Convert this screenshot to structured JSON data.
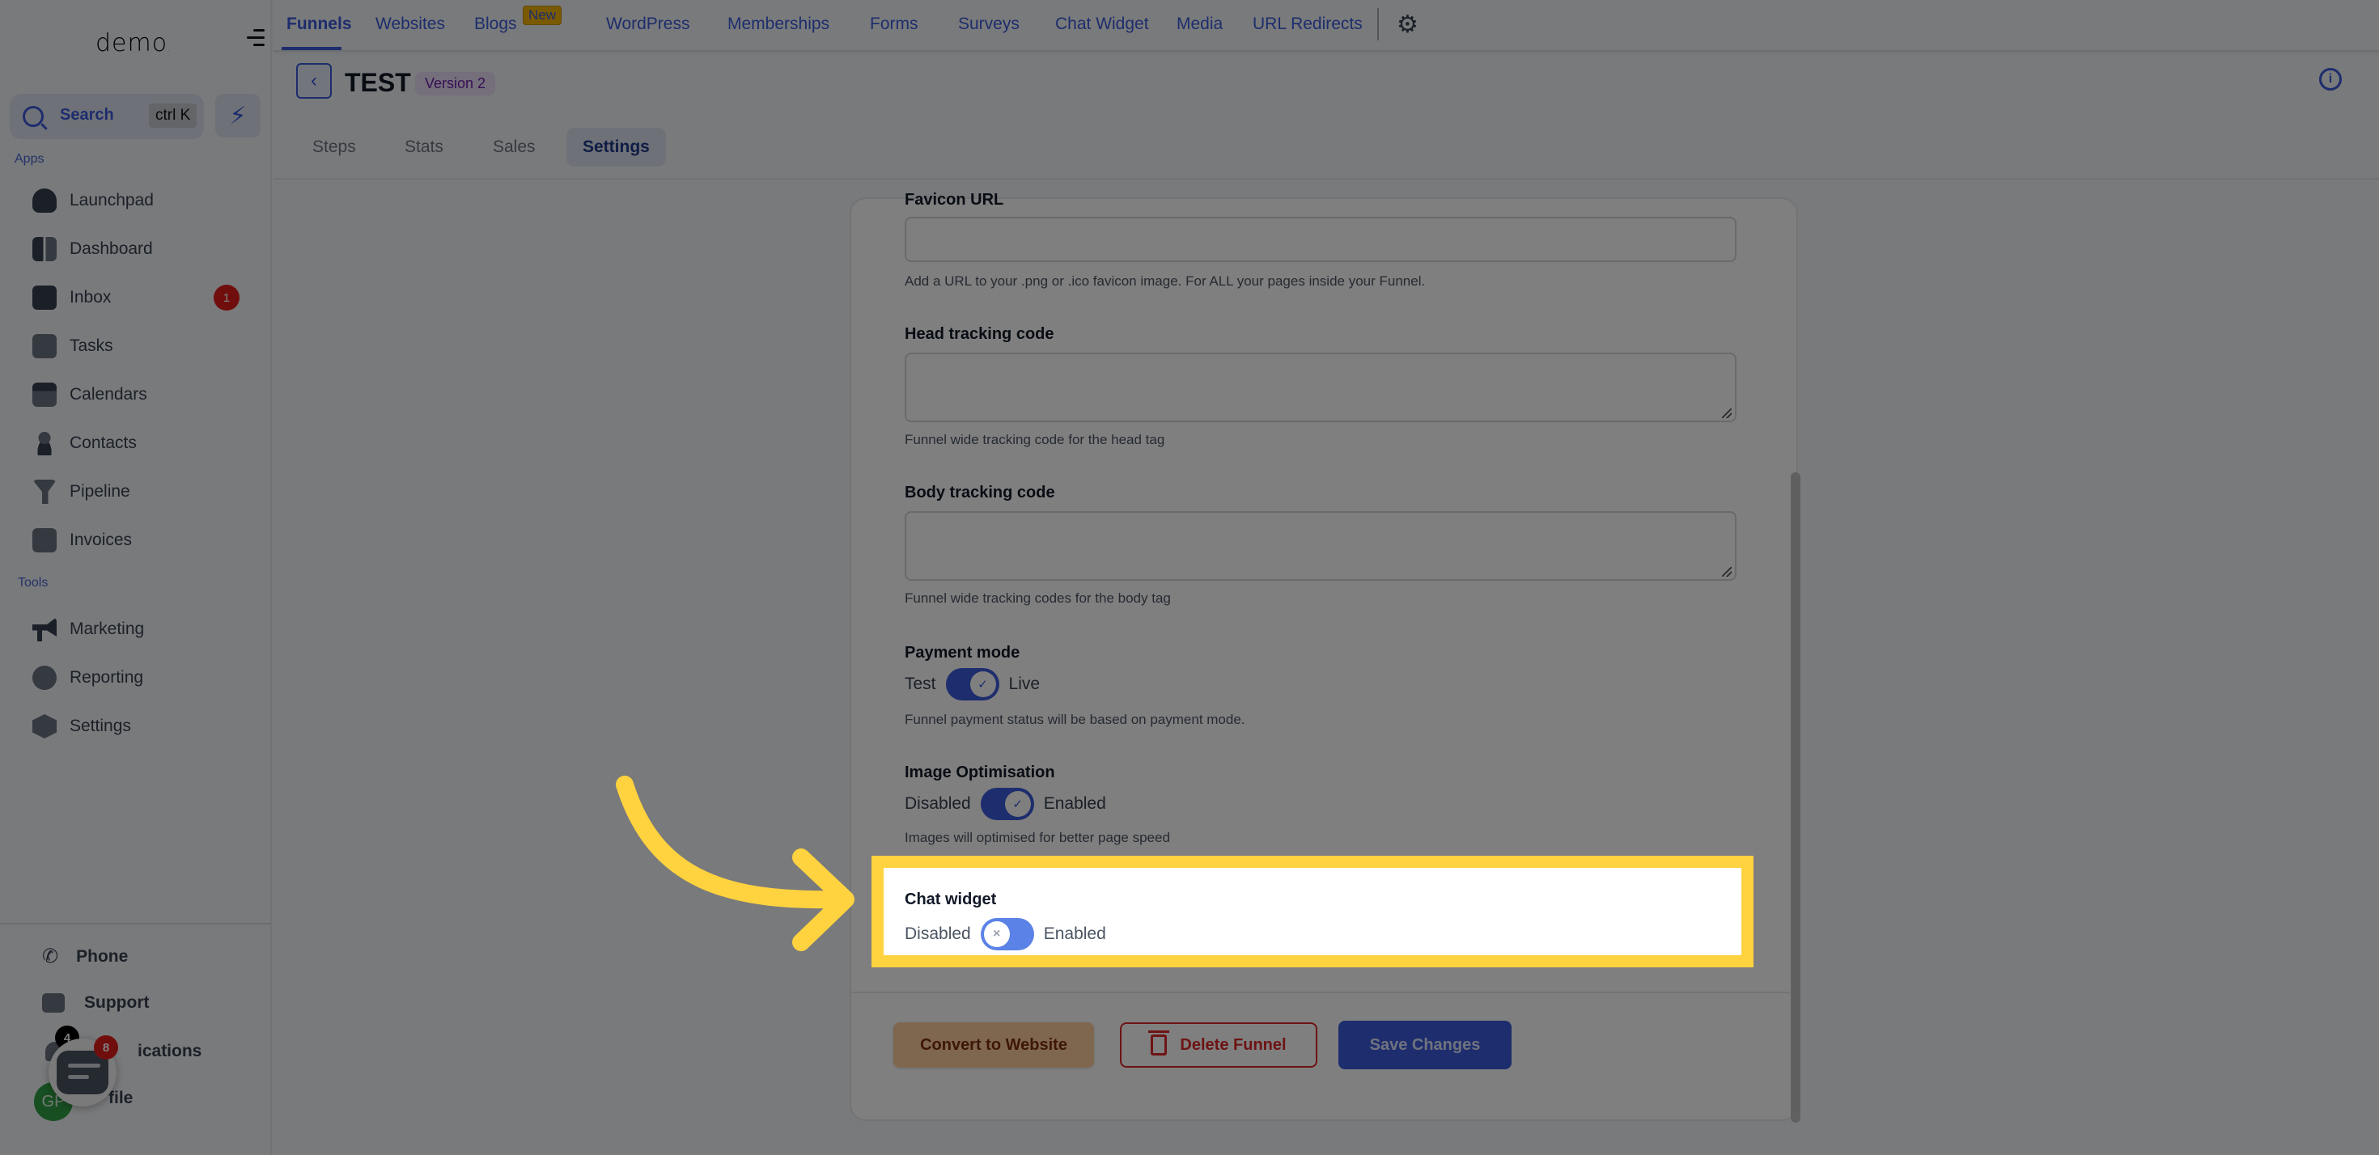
{
  "sidebar": {
    "logo": "demo",
    "search": {
      "label": "Search",
      "shortcut": "ctrl K"
    },
    "sections": {
      "apps": "Apps",
      "tools": "Tools"
    },
    "apps_items": [
      {
        "label": "Launchpad",
        "icon": "rocket-icon"
      },
      {
        "label": "Dashboard",
        "icon": "dashboard-grid-icon"
      },
      {
        "label": "Inbox",
        "icon": "inbox-icon",
        "badge": "1"
      },
      {
        "label": "Tasks",
        "icon": "clipboard-check-icon"
      },
      {
        "label": "Calendars",
        "icon": "calendar-icon"
      },
      {
        "label": "Contacts",
        "icon": "person-icon"
      },
      {
        "label": "Pipeline",
        "icon": "funnel-icon"
      },
      {
        "label": "Invoices",
        "icon": "receipt-icon"
      }
    ],
    "tools_items": [
      {
        "label": "Marketing",
        "icon": "megaphone-icon"
      },
      {
        "label": "Reporting",
        "icon": "pie-chart-icon"
      },
      {
        "label": "Settings",
        "icon": "settings-hex-icon"
      }
    ],
    "bottom_items": [
      {
        "label": "Phone",
        "icon": "phone-icon"
      },
      {
        "label": "Support",
        "icon": "chat-dots-icon"
      },
      {
        "label": "Notifications",
        "visible_label": "ications",
        "icon": "bell-icon",
        "badge": "4"
      },
      {
        "label": "Profile",
        "visible_label": "file",
        "avatar_initials": "GP"
      }
    ],
    "chat_fab_badge": "8"
  },
  "topnav": {
    "items": [
      {
        "label": "Funnels",
        "active": true
      },
      {
        "label": "Websites"
      },
      {
        "label": "Blogs",
        "badge": "New"
      },
      {
        "label": "WordPress"
      },
      {
        "label": "Memberships"
      },
      {
        "label": "Forms"
      },
      {
        "label": "Surveys"
      },
      {
        "label": "Chat Widget"
      },
      {
        "label": "Media"
      },
      {
        "label": "URL Redirects"
      }
    ]
  },
  "header": {
    "title": "TEST",
    "version": "Version 2",
    "subtabs": [
      {
        "label": "Steps"
      },
      {
        "label": "Stats"
      },
      {
        "label": "Sales"
      },
      {
        "label": "Settings",
        "active": true
      }
    ]
  },
  "settings": {
    "favicon": {
      "label": "Favicon URL",
      "value": "",
      "help": "Add a URL to your .png or .ico favicon image. For ALL your pages inside your Funnel."
    },
    "head_tracking": {
      "label": "Head tracking code",
      "value": "",
      "help": "Funnel wide tracking code for the head tag"
    },
    "body_tracking": {
      "label": "Body tracking code",
      "value": "",
      "help": "Funnel wide tracking codes for the body tag"
    },
    "payment_mode": {
      "label": "Payment mode",
      "off_label": "Test",
      "on_label": "Live",
      "checked": true,
      "help": "Funnel payment status will be based on payment mode."
    },
    "image_optimisation": {
      "label": "Image Optimisation",
      "off_label": "Disabled",
      "on_label": "Enabled",
      "checked": true,
      "help": "Images will optimised for better page speed"
    },
    "chat_widget": {
      "label": "Chat widget",
      "off_label": "Disabled",
      "on_label": "Enabled",
      "checked": false
    }
  },
  "actions": {
    "convert": "Convert to Website",
    "delete": "Delete Funnel",
    "save": "Save Changes"
  },
  "annotation": {
    "highlight_color": "#ffd23f",
    "target": "Chat widget toggle"
  },
  "colors": {
    "accent": "#3b5bdb",
    "danger": "#dc2626",
    "convert_bg": "#ffcf9e",
    "version_badge_bg": "#eadcf7"
  }
}
